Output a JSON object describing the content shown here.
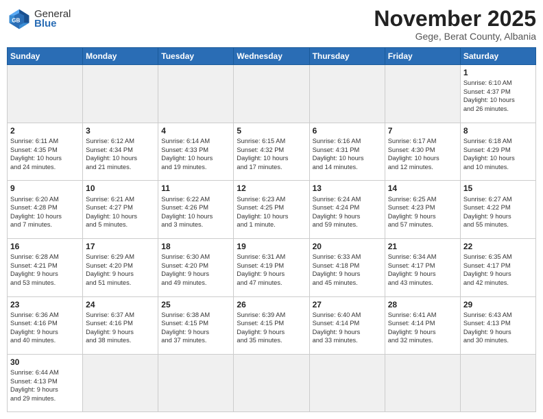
{
  "header": {
    "logo_general": "General",
    "logo_blue": "Blue",
    "month_title": "November 2025",
    "subtitle": "Gege, Berat County, Albania"
  },
  "weekdays": [
    "Sunday",
    "Monday",
    "Tuesday",
    "Wednesday",
    "Thursday",
    "Friday",
    "Saturday"
  ],
  "weeks": [
    [
      {
        "day": "",
        "info": "",
        "empty": true
      },
      {
        "day": "",
        "info": "",
        "empty": true
      },
      {
        "day": "",
        "info": "",
        "empty": true
      },
      {
        "day": "",
        "info": "",
        "empty": true
      },
      {
        "day": "",
        "info": "",
        "empty": true
      },
      {
        "day": "",
        "info": "",
        "empty": true
      },
      {
        "day": "1",
        "info": "Sunrise: 6:10 AM\nSunset: 4:37 PM\nDaylight: 10 hours\nand 26 minutes."
      }
    ],
    [
      {
        "day": "2",
        "info": "Sunrise: 6:11 AM\nSunset: 4:35 PM\nDaylight: 10 hours\nand 24 minutes."
      },
      {
        "day": "3",
        "info": "Sunrise: 6:12 AM\nSunset: 4:34 PM\nDaylight: 10 hours\nand 21 minutes."
      },
      {
        "day": "4",
        "info": "Sunrise: 6:14 AM\nSunset: 4:33 PM\nDaylight: 10 hours\nand 19 minutes."
      },
      {
        "day": "5",
        "info": "Sunrise: 6:15 AM\nSunset: 4:32 PM\nDaylight: 10 hours\nand 17 minutes."
      },
      {
        "day": "6",
        "info": "Sunrise: 6:16 AM\nSunset: 4:31 PM\nDaylight: 10 hours\nand 14 minutes."
      },
      {
        "day": "7",
        "info": "Sunrise: 6:17 AM\nSunset: 4:30 PM\nDaylight: 10 hours\nand 12 minutes."
      },
      {
        "day": "8",
        "info": "Sunrise: 6:18 AM\nSunset: 4:29 PM\nDaylight: 10 hours\nand 10 minutes."
      }
    ],
    [
      {
        "day": "9",
        "info": "Sunrise: 6:20 AM\nSunset: 4:28 PM\nDaylight: 10 hours\nand 7 minutes."
      },
      {
        "day": "10",
        "info": "Sunrise: 6:21 AM\nSunset: 4:27 PM\nDaylight: 10 hours\nand 5 minutes."
      },
      {
        "day": "11",
        "info": "Sunrise: 6:22 AM\nSunset: 4:26 PM\nDaylight: 10 hours\nand 3 minutes."
      },
      {
        "day": "12",
        "info": "Sunrise: 6:23 AM\nSunset: 4:25 PM\nDaylight: 10 hours\nand 1 minute."
      },
      {
        "day": "13",
        "info": "Sunrise: 6:24 AM\nSunset: 4:24 PM\nDaylight: 9 hours\nand 59 minutes."
      },
      {
        "day": "14",
        "info": "Sunrise: 6:25 AM\nSunset: 4:23 PM\nDaylight: 9 hours\nand 57 minutes."
      },
      {
        "day": "15",
        "info": "Sunrise: 6:27 AM\nSunset: 4:22 PM\nDaylight: 9 hours\nand 55 minutes."
      }
    ],
    [
      {
        "day": "16",
        "info": "Sunrise: 6:28 AM\nSunset: 4:21 PM\nDaylight: 9 hours\nand 53 minutes."
      },
      {
        "day": "17",
        "info": "Sunrise: 6:29 AM\nSunset: 4:20 PM\nDaylight: 9 hours\nand 51 minutes."
      },
      {
        "day": "18",
        "info": "Sunrise: 6:30 AM\nSunset: 4:20 PM\nDaylight: 9 hours\nand 49 minutes."
      },
      {
        "day": "19",
        "info": "Sunrise: 6:31 AM\nSunset: 4:19 PM\nDaylight: 9 hours\nand 47 minutes."
      },
      {
        "day": "20",
        "info": "Sunrise: 6:33 AM\nSunset: 4:18 PM\nDaylight: 9 hours\nand 45 minutes."
      },
      {
        "day": "21",
        "info": "Sunrise: 6:34 AM\nSunset: 4:17 PM\nDaylight: 9 hours\nand 43 minutes."
      },
      {
        "day": "22",
        "info": "Sunrise: 6:35 AM\nSunset: 4:17 PM\nDaylight: 9 hours\nand 42 minutes."
      }
    ],
    [
      {
        "day": "23",
        "info": "Sunrise: 6:36 AM\nSunset: 4:16 PM\nDaylight: 9 hours\nand 40 minutes."
      },
      {
        "day": "24",
        "info": "Sunrise: 6:37 AM\nSunset: 4:16 PM\nDaylight: 9 hours\nand 38 minutes."
      },
      {
        "day": "25",
        "info": "Sunrise: 6:38 AM\nSunset: 4:15 PM\nDaylight: 9 hours\nand 37 minutes."
      },
      {
        "day": "26",
        "info": "Sunrise: 6:39 AM\nSunset: 4:15 PM\nDaylight: 9 hours\nand 35 minutes."
      },
      {
        "day": "27",
        "info": "Sunrise: 6:40 AM\nSunset: 4:14 PM\nDaylight: 9 hours\nand 33 minutes."
      },
      {
        "day": "28",
        "info": "Sunrise: 6:41 AM\nSunset: 4:14 PM\nDaylight: 9 hours\nand 32 minutes."
      },
      {
        "day": "29",
        "info": "Sunrise: 6:43 AM\nSunset: 4:13 PM\nDaylight: 9 hours\nand 30 minutes."
      }
    ],
    [
      {
        "day": "30",
        "info": "Sunrise: 6:44 AM\nSunset: 4:13 PM\nDaylight: 9 hours\nand 29 minutes.",
        "last": true
      },
      {
        "day": "",
        "info": "",
        "empty": true,
        "last": true
      },
      {
        "day": "",
        "info": "",
        "empty": true,
        "last": true
      },
      {
        "day": "",
        "info": "",
        "empty": true,
        "last": true
      },
      {
        "day": "",
        "info": "",
        "empty": true,
        "last": true
      },
      {
        "day": "",
        "info": "",
        "empty": true,
        "last": true
      },
      {
        "day": "",
        "info": "",
        "empty": true,
        "last": true
      }
    ]
  ]
}
